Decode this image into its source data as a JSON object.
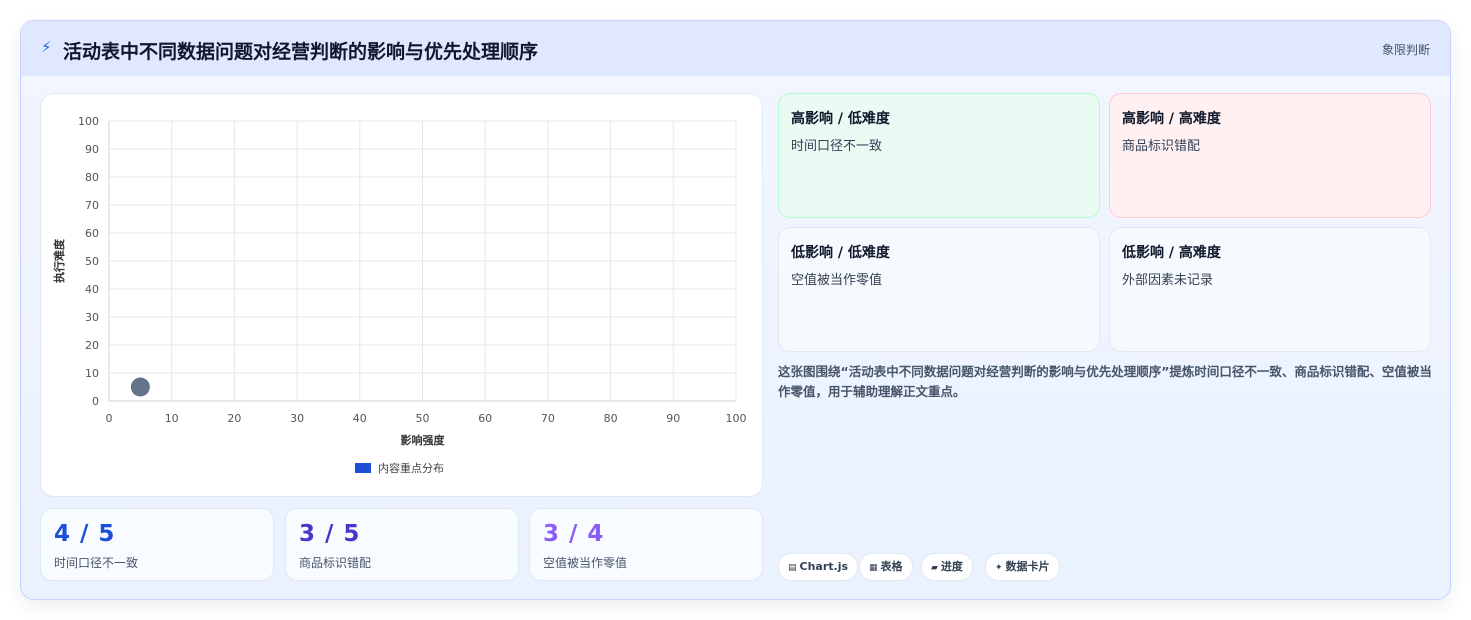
{
  "header": {
    "icon": "lightning-icon",
    "title": "活动表中不同数据问题对经营判断的影响与优先处理顺序",
    "tag": "象限判断"
  },
  "chart_data": {
    "type": "scatter",
    "xlabel": "影响强度",
    "ylabel": "执行难度",
    "xlim": [
      0,
      100
    ],
    "ylim": [
      0,
      100
    ],
    "xticks": [
      0,
      10,
      20,
      30,
      40,
      50,
      60,
      70,
      80,
      90,
      100
    ],
    "yticks": [
      0,
      10,
      20,
      30,
      40,
      50,
      60,
      70,
      80,
      90,
      100
    ],
    "grid": true,
    "legend": "bottom",
    "series": [
      {
        "name": "内容重点分布",
        "color": "#1d4ed8",
        "points": [
          {
            "x": 5,
            "y": 5
          }
        ]
      }
    ],
    "point_color": "#64748b"
  },
  "stats": [
    {
      "value": "4 / 5",
      "label": "时间口径不一致",
      "color": "#1d4ed8"
    },
    {
      "value": "3 / 5",
      "label": "商品标识错配",
      "color": "#4338ca"
    },
    {
      "value": "3 / 4",
      "label": "空值被当作零值",
      "color": "#8b5cf6"
    }
  ],
  "quadrants": [
    {
      "title": "高影响 / 低难度",
      "item": "时间口径不一致"
    },
    {
      "title": "高影响 / 高难度",
      "item": "商品标识错配"
    },
    {
      "title": "低影响 / 低难度",
      "item": "空值被当作零值"
    },
    {
      "title": "低影响 / 高难度",
      "item": "外部因素未记录"
    }
  ],
  "description": "这张图围绕“活动表中不同数据问题对经营判断的影响与优先处理顺序”提炼时间口径不一致、商品标识错配、空值被当作零值，用于辅助理解正文重点。",
  "pills": [
    {
      "icon": "▤",
      "label": "Chart.js"
    },
    {
      "icon": "▦",
      "label": "表格"
    },
    {
      "icon": "▰",
      "label": "进度"
    },
    {
      "icon": "✦",
      "label": "数据卡片"
    }
  ]
}
